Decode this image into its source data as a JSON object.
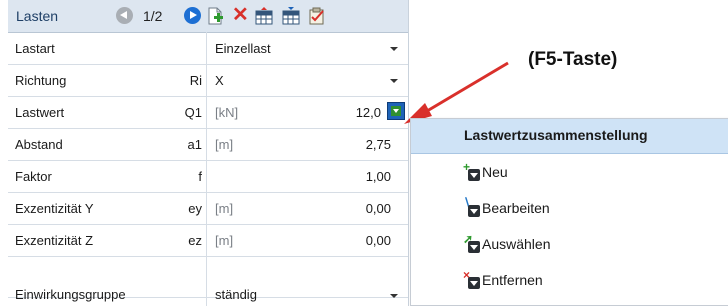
{
  "grid": {
    "header": {
      "title": "Lasten",
      "pager": "1/2"
    },
    "rows": [
      {
        "label": "Lastart",
        "symbol": "",
        "unit": "",
        "value": "Einzellast"
      },
      {
        "label": "Richtung",
        "symbol": "Ri",
        "unit": "",
        "value": "X"
      },
      {
        "label": "Lastwert",
        "symbol": "Q1",
        "unit": "[kN]",
        "value": "12,0"
      },
      {
        "label": "Abstand",
        "symbol": "a1",
        "unit": "[m]",
        "value": "2,75"
      },
      {
        "label": "Faktor",
        "symbol": "f",
        "unit": "",
        "value": "1,00"
      },
      {
        "label": "Exzentizität Y",
        "symbol": "ey",
        "unit": "[m]",
        "value": "0,00"
      },
      {
        "label": "Exzentizität Z",
        "symbol": "ez",
        "unit": "[m]",
        "value": "0,00"
      },
      {
        "label": "Einwirkungsgruppe",
        "symbol": "",
        "unit": "",
        "value": "ständig"
      }
    ]
  },
  "annotation": {
    "text": "(F5-Taste)",
    "arrow_color": "#d9302b"
  },
  "menu": {
    "title": "Lastwertzusammenstellung",
    "items": [
      {
        "label": "Neu",
        "icon": "add-icon",
        "mark": "+",
        "mark_color": "#2f9a2f"
      },
      {
        "label": "Bearbeiten",
        "icon": "edit-icon",
        "mark": "∖",
        "mark_color": "#2478c8"
      },
      {
        "label": "Auswählen",
        "icon": "select-icon",
        "mark": "➚",
        "mark_color": "#2f9a2f"
      },
      {
        "label": "Entfernen",
        "icon": "remove-icon",
        "mark": "×",
        "mark_color": "#d8302a"
      }
    ]
  },
  "colors": {
    "toolbar_bg": "#dde6f0",
    "menu_header_bg": "#cfe3f6",
    "accent_blue": "#1e63b8"
  }
}
